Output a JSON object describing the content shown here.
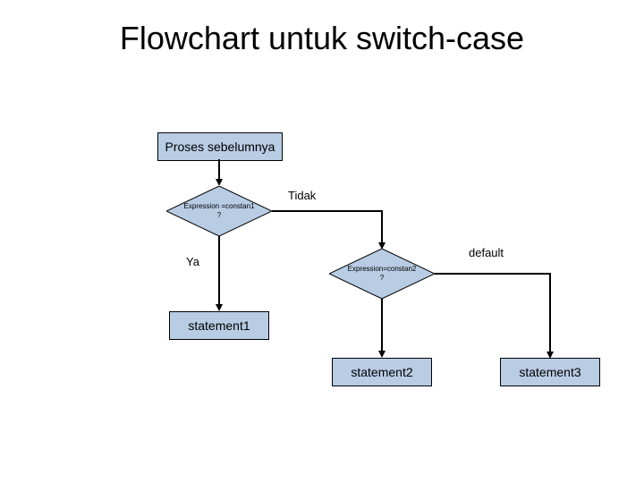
{
  "title": "Flowchart untuk switch-case",
  "nodes": {
    "prev": "Proses sebelumnya",
    "d1": "Expression =constan1\n?",
    "d2": "Expression=constan2\n?",
    "s1": "statement1",
    "s2": "statement2",
    "s3": "statement3"
  },
  "labels": {
    "tidak": "Tidak",
    "ya": "Ya",
    "default": "default"
  },
  "colors": {
    "fill": "#b8cce4"
  }
}
